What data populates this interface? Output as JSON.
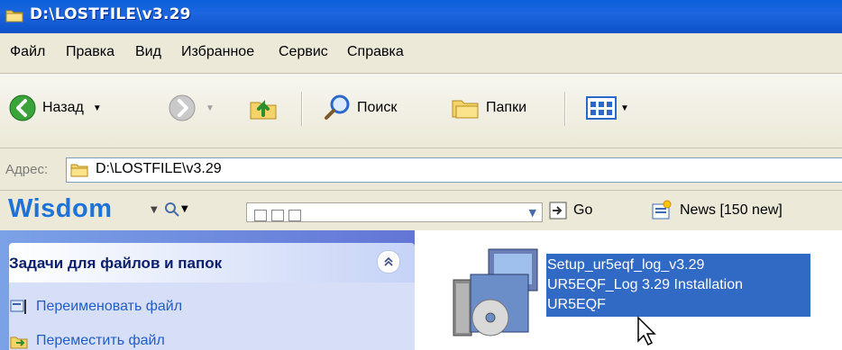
{
  "window": {
    "title": "D:\\LOSTFILE\\v3.29"
  },
  "menu": [
    "Файл",
    "Правка",
    "Вид",
    "Избранное",
    "Сервис",
    "Справка"
  ],
  "toolbar": {
    "back_label": "Назад",
    "search_label": "Поиск",
    "folders_label": "Папки"
  },
  "address": {
    "label": "Адрес:",
    "value": "D:\\LOSTFILE\\v3.29"
  },
  "wisdom": {
    "logo": "Wisdom",
    "go_label": "Go",
    "news_label": "News [150 new]"
  },
  "tasks": {
    "header": "Задачи для файлов и папок",
    "items": [
      "Переименовать файл",
      "Переместить файл"
    ]
  },
  "file": {
    "line1": "Setup_ur5eqf_log_v3.29",
    "line2": "UR5EQF_Log 3.29 Installation",
    "line3": "UR5EQF"
  },
  "colors": {
    "titlebar": "#0a5fd8",
    "selection": "#316ac5",
    "task_link": "#215dc6",
    "wisdom_logo": "#1e73d8"
  }
}
